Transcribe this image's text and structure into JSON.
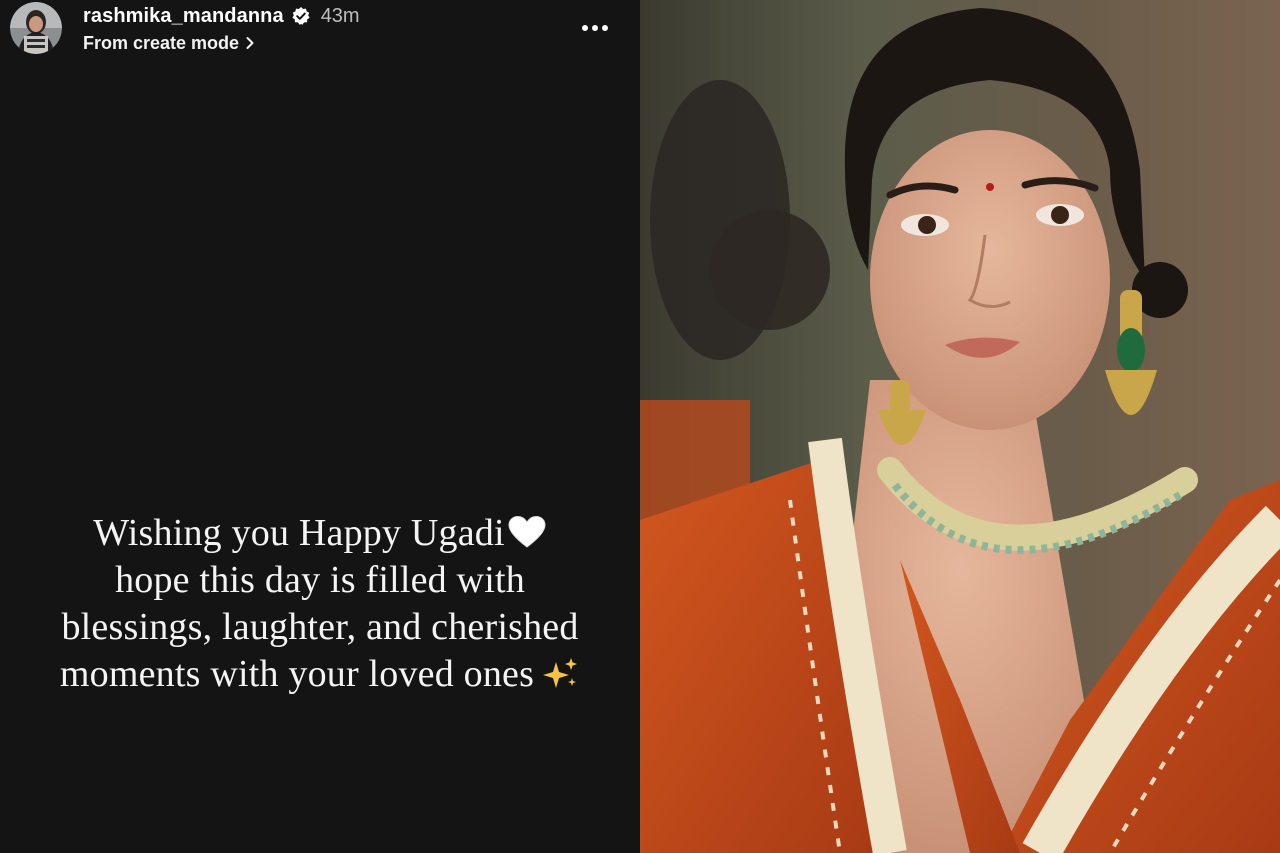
{
  "story": {
    "username": "rashmika_mandanna",
    "timestamp": "43m",
    "subtitle": "From create mode",
    "text_lines": [
      "Wishing you Happy Ugadi",
      "hope this day is filled with",
      "blessings, laughter, and cherished",
      "moments with your loved ones"
    ],
    "icons": {
      "verified": "verified-badge-icon",
      "subtitle_chevron": "chevron-right-icon",
      "more": "more-options-icon",
      "heart": "white-heart-emoji",
      "sparkles": "sparkles-emoji"
    }
  },
  "photo": {
    "subject": "portrait-photo"
  },
  "colors": {
    "story_bg": "#141414",
    "text": "#f4f4f4",
    "timestamp": "#bdbdbd",
    "saree": "#c24a1c",
    "sparkle": "#f5c542"
  }
}
